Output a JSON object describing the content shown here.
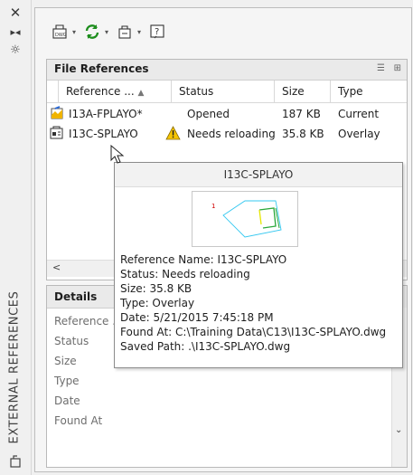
{
  "palette": {
    "title": "EXTERNAL REFERENCES"
  },
  "strip": {
    "close_icon": "close-icon",
    "autohide_icon": "autohide-icon",
    "properties_icon": "properties-icon",
    "bottom_icon": "xref-icon"
  },
  "toolbar": {
    "attach_icon": "attach-dwg-icon",
    "refresh_icon": "refresh-icon",
    "change_path_icon": "change-path-icon",
    "help_icon": "help-icon"
  },
  "file_refs": {
    "title": "File References",
    "columns": [
      "Reference ...",
      "Status",
      "Size",
      "Type"
    ],
    "rows": [
      {
        "name": "I13A-FPLAYO*",
        "status": "Opened",
        "size": "187 KB",
        "type": "Current"
      },
      {
        "name": "I13C-SPLAYO",
        "status": "Needs reloading",
        "size": "35.8 KB",
        "type": "Overlay"
      }
    ]
  },
  "details": {
    "title": "Details",
    "labels": [
      "Reference ...",
      "Status",
      "Size",
      "Type",
      "Date",
      "Found At"
    ]
  },
  "tooltip": {
    "title": "I13C-SPLAYO",
    "lines": [
      "Reference Name: I13C-SPLAYO",
      "Status: Needs reloading",
      "Size: 35.8 KB",
      "Type: Overlay",
      "Date: 5/21/2015 7:45:18 PM",
      "Found At: C:\\Training Data\\C13\\I13C-SPLAYO.dwg",
      "Saved Path: .\\I13C-SPLAYO.dwg"
    ]
  }
}
